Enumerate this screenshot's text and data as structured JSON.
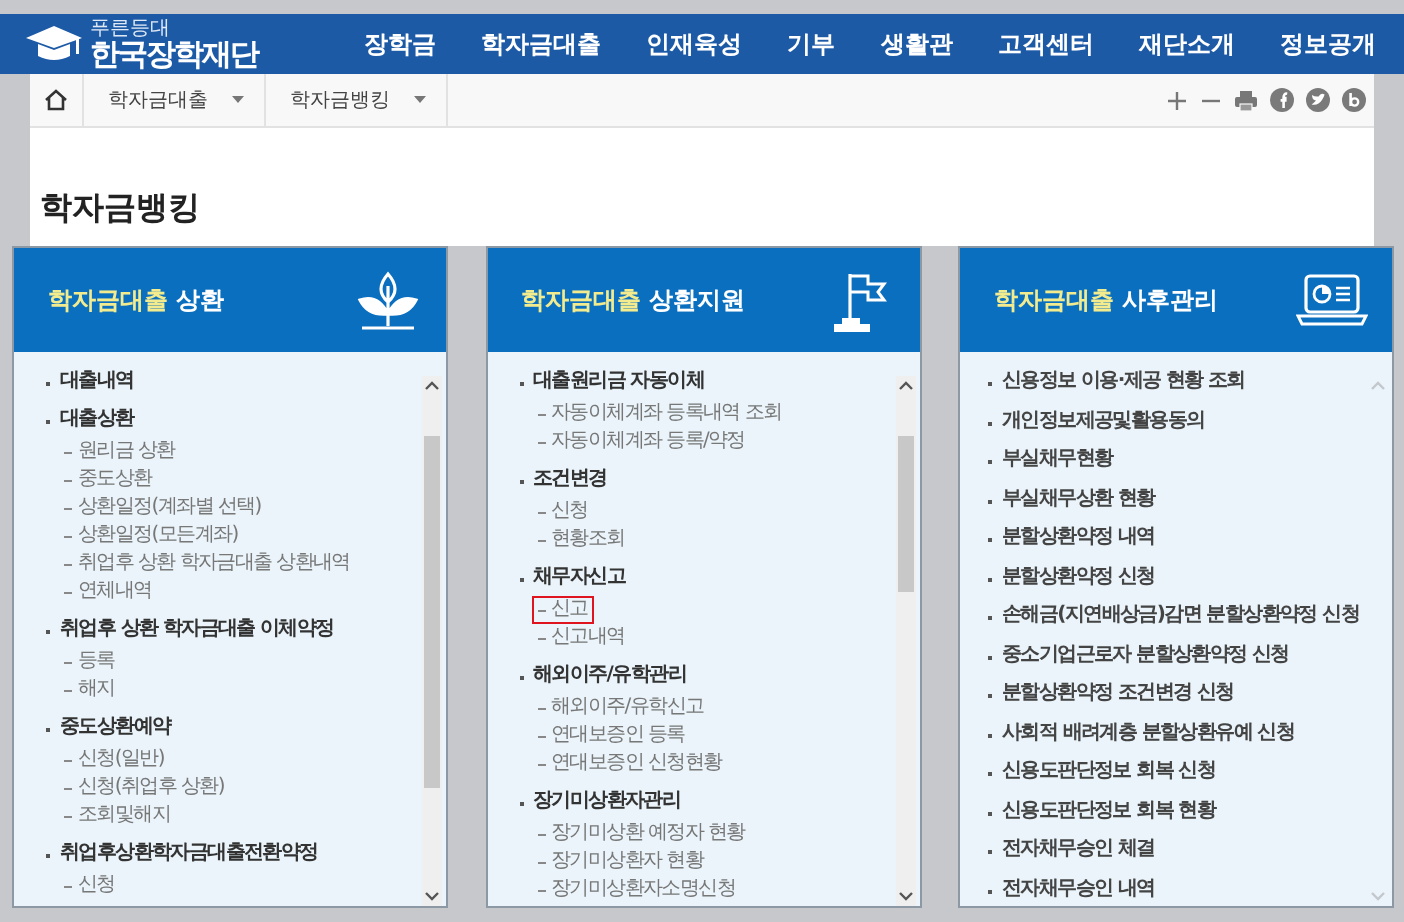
{
  "header": {
    "logo_tagline": "푸른등대",
    "logo_name": "한국장학재단",
    "nav": [
      {
        "label": "장학금"
      },
      {
        "label": "학자금대출"
      },
      {
        "label": "인재육성"
      },
      {
        "label": "기부"
      },
      {
        "label": "생활관"
      },
      {
        "label": "고객센터"
      },
      {
        "label": "재단소개"
      },
      {
        "label": "정보공개"
      }
    ]
  },
  "breadcrumb": [
    {
      "label": "학자금대출"
    },
    {
      "label": "학자금뱅킹"
    }
  ],
  "page_title": "학자금뱅킹",
  "cards": [
    {
      "title_highlight": "학자금대출",
      "title_rest": "상환",
      "scrollable": true,
      "items": [
        {
          "label": "대출내역"
        },
        {
          "label": "대출상환",
          "children": [
            {
              "label": "원리금 상환",
              "highlighted": false
            },
            {
              "label": "중도상환",
              "highlighted": false
            },
            {
              "label": "상환일정(계좌별 선택)",
              "highlighted": false
            },
            {
              "label": "상환일정(모든계좌)",
              "highlighted": false
            },
            {
              "label": "취업후 상환 학자금대출 상환내역",
              "highlighted": false
            },
            {
              "label": "연체내역",
              "highlighted": false
            }
          ]
        },
        {
          "label": "취업후 상환 학자금대출 이체약정",
          "children": [
            {
              "label": "등록",
              "highlighted": false
            },
            {
              "label": "해지",
              "highlighted": false
            }
          ]
        },
        {
          "label": "중도상환예약",
          "children": [
            {
              "label": "신청(일반)",
              "highlighted": false
            },
            {
              "label": "신청(취업후 상환)",
              "highlighted": false
            },
            {
              "label": "조회및해지",
              "highlighted": false
            }
          ]
        },
        {
          "label": "취업후상환학자금대출전환약정",
          "children": [
            {
              "label": "신청",
              "highlighted": false
            }
          ]
        }
      ]
    },
    {
      "title_highlight": "학자금대출",
      "title_rest": "상환지원",
      "scrollable": true,
      "items": [
        {
          "label": "대출원리금 자동이체",
          "children": [
            {
              "label": "자동이체계좌 등록내역 조회",
              "highlighted": false
            },
            {
              "label": "자동이체계좌 등록/약정",
              "highlighted": false
            }
          ]
        },
        {
          "label": "조건변경",
          "children": [
            {
              "label": "신청",
              "highlighted": false
            },
            {
              "label": "현황조회",
              "highlighted": false
            }
          ]
        },
        {
          "label": "채무자신고",
          "children": [
            {
              "label": "신고",
              "highlighted": true
            },
            {
              "label": "신고내역",
              "highlighted": false
            }
          ]
        },
        {
          "label": "해외이주/유학관리",
          "children": [
            {
              "label": "해외이주/유학신고",
              "highlighted": false
            },
            {
              "label": "연대보증인 등록",
              "highlighted": false
            },
            {
              "label": "연대보증인 신청현황",
              "highlighted": false
            }
          ]
        },
        {
          "label": "장기미상환자관리",
          "children": [
            {
              "label": "장기미상환 예정자 현황",
              "highlighted": false
            },
            {
              "label": "장기미상환자 현황",
              "highlighted": false
            },
            {
              "label": "장기미상환자소명신청",
              "highlighted": false
            }
          ]
        }
      ]
    },
    {
      "title_highlight": "학자금대출",
      "title_rest": "사후관리",
      "scrollable": false,
      "items": [
        {
          "label": "신용정보 이용·제공 현황 조회"
        },
        {
          "label": "개인정보제공및활용동의"
        },
        {
          "label": "부실채무현황"
        },
        {
          "label": "부실채무상환 현황"
        },
        {
          "label": "분할상환약정 내역"
        },
        {
          "label": "분할상환약정 신청"
        },
        {
          "label": "손해금(지연배상금)감면 분할상환약정 신청"
        },
        {
          "label": "중소기업근로자 분할상환약정 신청"
        },
        {
          "label": "분할상환약정 조건변경 신청"
        },
        {
          "label": "사회적 배려계층 분할상환유예 신청"
        },
        {
          "label": "신용도판단정보 회복 신청"
        },
        {
          "label": "신용도판단정보 회복 현황"
        },
        {
          "label": "전자채무승인 체결"
        },
        {
          "label": "전자채무승인 내역"
        }
      ]
    }
  ]
}
